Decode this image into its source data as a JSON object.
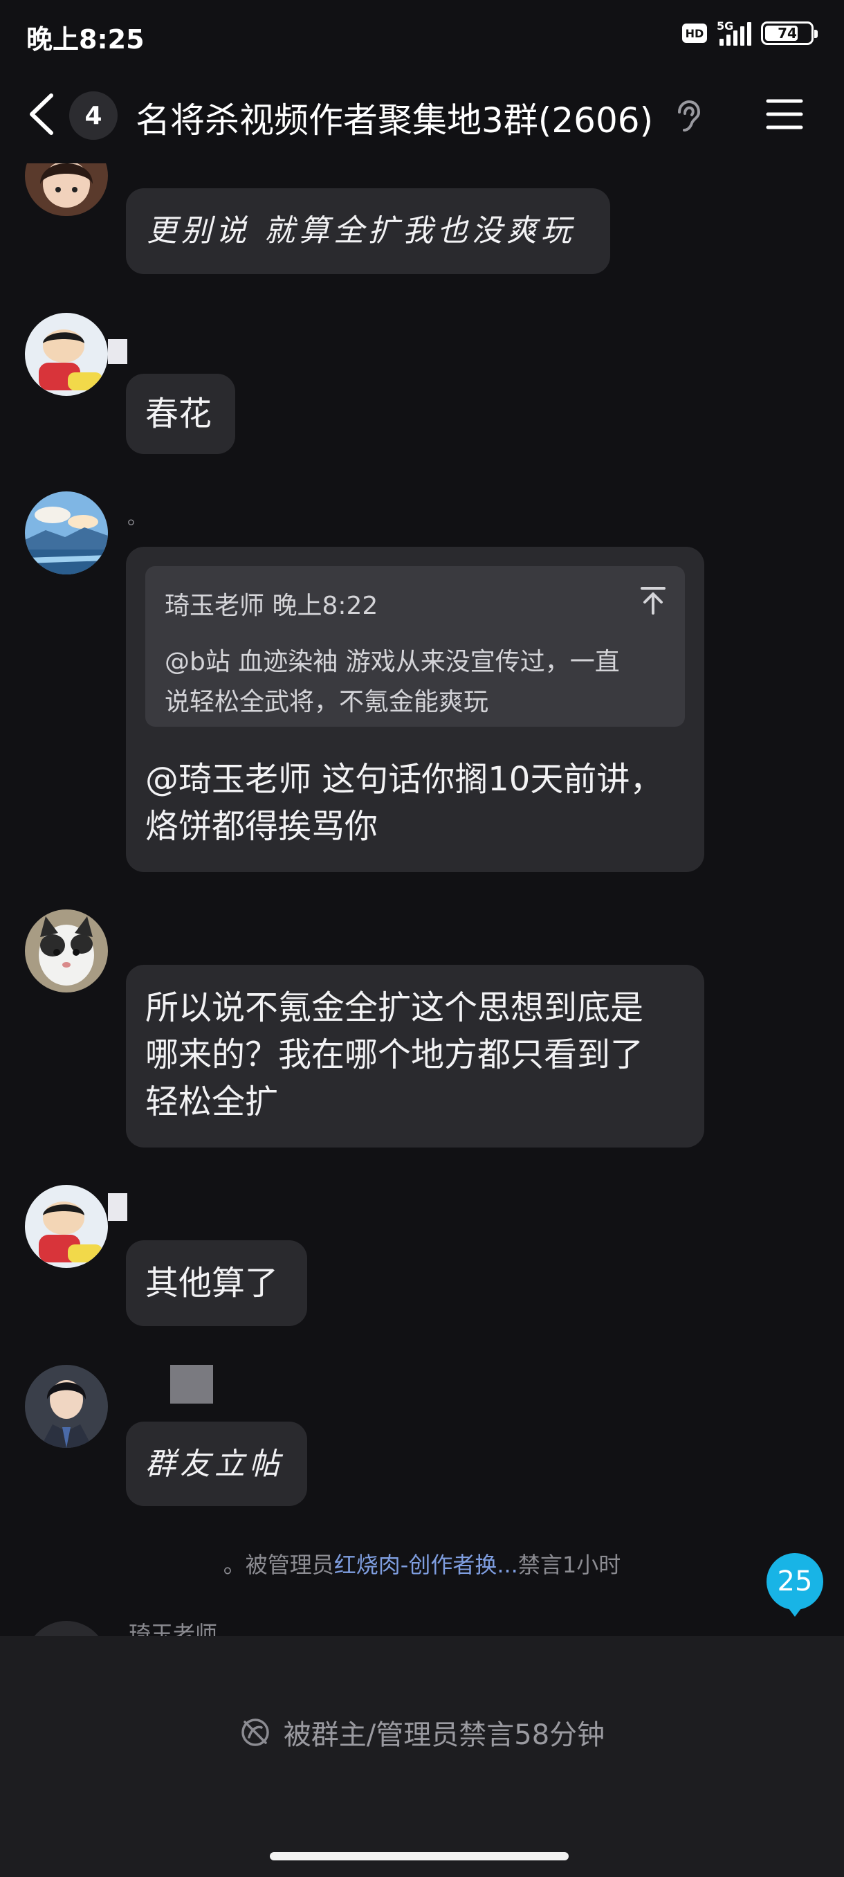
{
  "status_bar": {
    "time": "晚上8:25",
    "hd": "HD",
    "network": "5G",
    "signal_level": 4,
    "battery_percent": 74,
    "battery_label": "74"
  },
  "header": {
    "unread_count": "4",
    "title": "名将杀视频作者聚集地3群(2606)",
    "back_icon": "back-chevron-icon",
    "ear_icon": "hearing-ear-icon",
    "menu_icon": "menu-icon"
  },
  "messages": [
    {
      "text": "更别说 就算全扩我也没爽玩",
      "style": "stylized"
    },
    {
      "text": "春花"
    },
    {
      "sender": "。",
      "quote": {
        "author_time": "琦玉老师 晚上8:22",
        "line1": "@b站 血迹染袖 游戏从来没宣传过，一直",
        "line2": "说轻松全武将，不氪金能爽玩"
      },
      "line1": "@琦玉老师 这句话你搁10天前讲，",
      "line2": "烙饼都得挨骂你"
    },
    {
      "line1": "所以说不氪金全扩这个思想到底是",
      "line2": "哪来的？我在哪个地方都只看到了",
      "line3": "轻松全扩"
    },
    {
      "text": "其他算了"
    },
    {
      "text": "群友立帖",
      "style": "stylized"
    }
  ],
  "system_notice": {
    "prefix": "。被管理员",
    "admin": "红烧肉-创作者换...",
    "suffix": "禁言1小时"
  },
  "new_message_count": "25",
  "partial_sender": "琦玉老师",
  "mute_panel": {
    "icon": "muted-icon",
    "text": "被群主/管理员禁言58分钟"
  },
  "colors": {
    "background": "#111114",
    "bubble": "#2a2a2e",
    "quote": "#3a3a3f",
    "accent_badge": "#18b4e6",
    "link": "#7f9ee0"
  }
}
